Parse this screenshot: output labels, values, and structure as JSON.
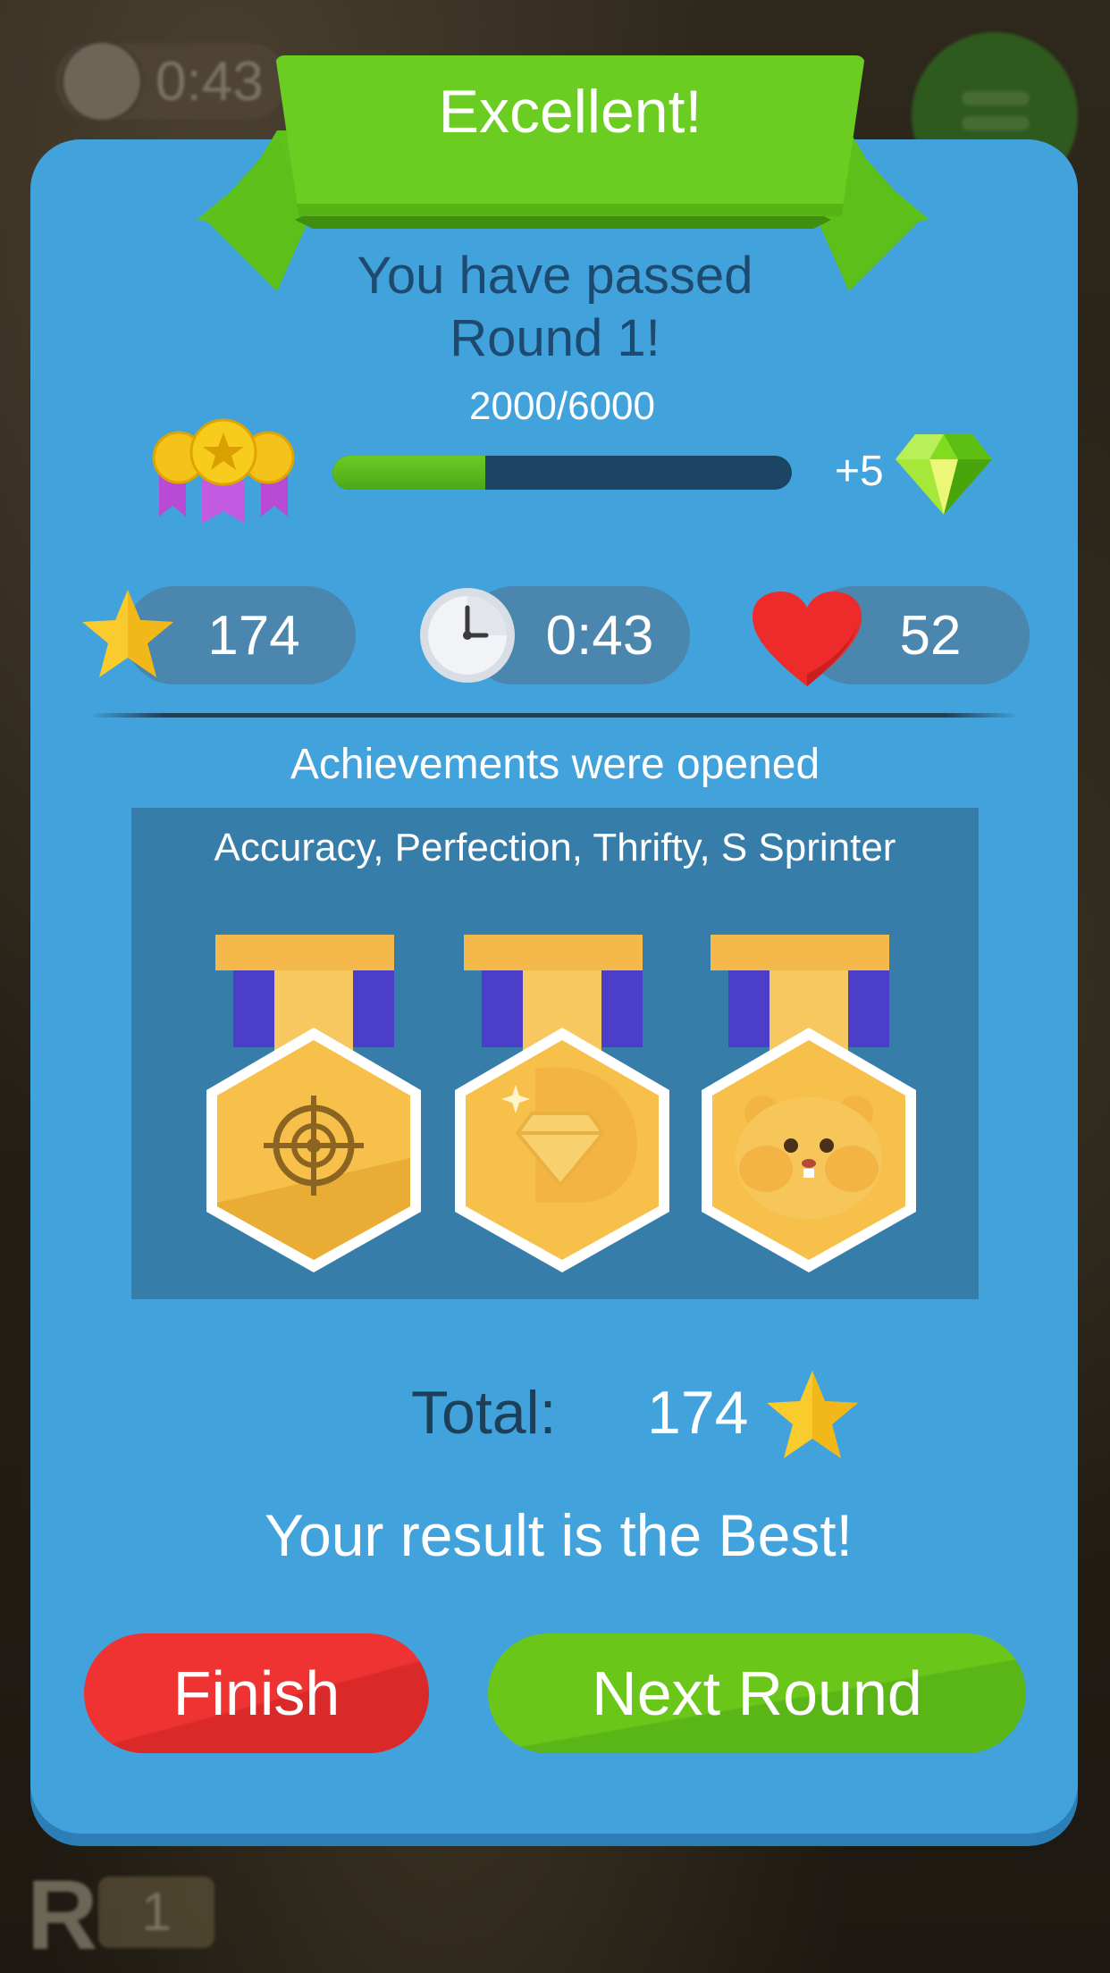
{
  "background": {
    "timer_text": "0:43",
    "round_letter": "R",
    "round_number": "1"
  },
  "banner": {
    "title": "Excellent!"
  },
  "result": {
    "line1": "You have passed",
    "line2": "Round 1!",
    "score_text": "2000/6000",
    "progress_fraction": 0.333,
    "reward_text": "+5"
  },
  "stats": {
    "stars": "174",
    "time": "0:43",
    "lives": "52"
  },
  "achievements": {
    "title": "Achievements were opened",
    "list_text": "Accuracy, Perfection, Thrifty, S Sprinter",
    "medals": [
      {
        "icon": "target-icon"
      },
      {
        "icon": "diamond-hand-icon"
      },
      {
        "icon": "hamster-icon"
      }
    ]
  },
  "total": {
    "label": "Total:",
    "value": "174"
  },
  "best_text": "Your result is the Best!",
  "buttons": {
    "finish": "Finish",
    "next": "Next Round"
  },
  "colors": {
    "panel": "#41a2dc",
    "ribbon": "#6bcd22",
    "finish": "#ef3232",
    "next": "#6ac71a",
    "dark_text": "#1d4a6e"
  }
}
